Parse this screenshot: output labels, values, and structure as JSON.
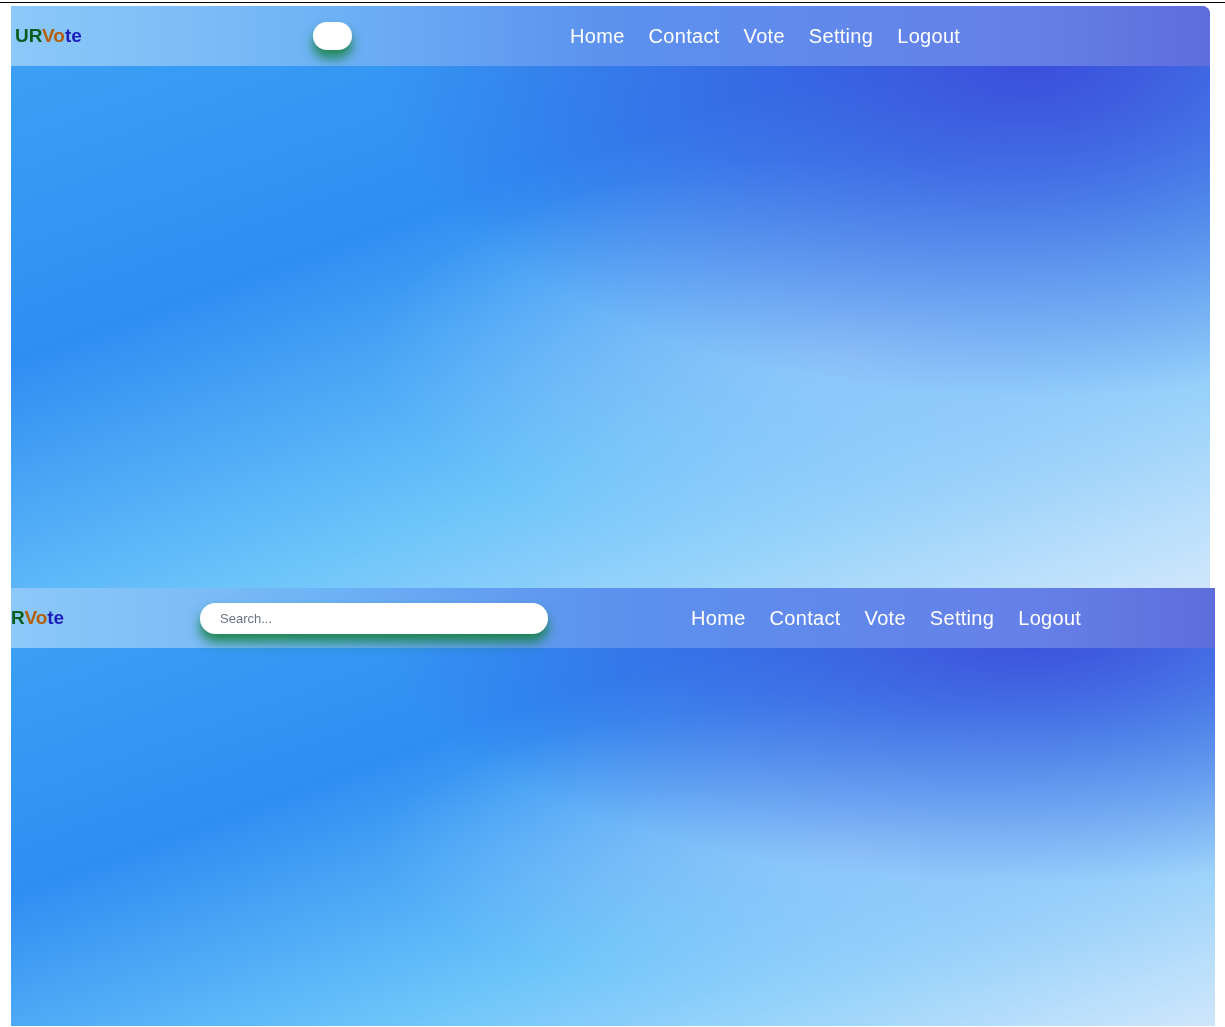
{
  "panels": [
    {
      "logo": [
        {
          "text": "UR",
          "color": "#0b5d1e"
        },
        {
          "text": "Vo",
          "color": "#b45f06"
        },
        {
          "text": "te",
          "color": "#1d1db8"
        }
      ],
      "search": {
        "expanded": false
      },
      "nav": [
        "Home",
        "Contact",
        "Vote",
        "Setting",
        "Logout"
      ]
    },
    {
      "logo": [
        {
          "text": "R",
          "color": "#0b5d1e"
        },
        {
          "text": "Vo",
          "color": "#b45f06"
        },
        {
          "text": "te",
          "color": "#1d1db8"
        }
      ],
      "search": {
        "expanded": true,
        "placeholder": "Search..."
      },
      "nav": [
        "Home",
        "Contact",
        "Vote",
        "Setting",
        "Logout"
      ]
    }
  ]
}
